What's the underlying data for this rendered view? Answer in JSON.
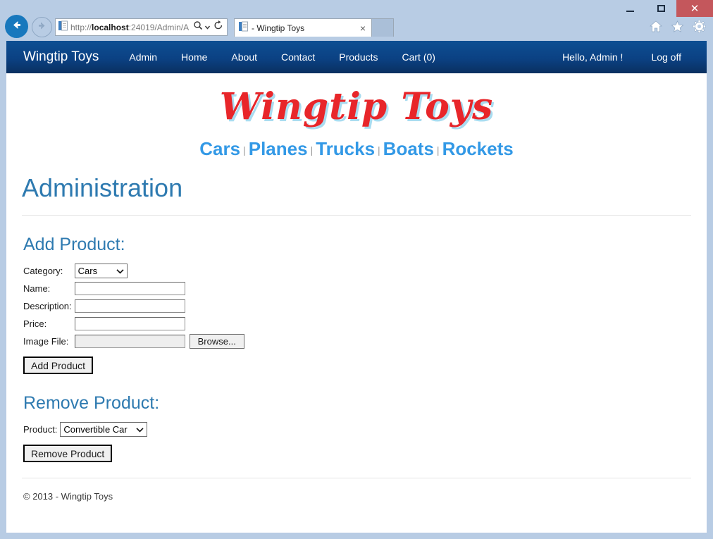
{
  "browser": {
    "url_prefix": "http://",
    "url_host": "localhost",
    "url_rest": ":24019/Admin/A",
    "tab_title": "- Wingtip Toys",
    "tab_close_label": "×",
    "new_tab_label": "",
    "window_controls": {
      "minimize": "minimize-button",
      "maximize": "maximize-button",
      "close_label": "✕"
    },
    "toolbar_icons": [
      "home-icon",
      "favorites-star-icon",
      "settings-gear-icon"
    ],
    "nav_icons": [
      "back-icon",
      "forward-icon"
    ],
    "address_icons": [
      "page-icon",
      "search-icon",
      "dropdown-icon",
      "refresh-icon"
    ]
  },
  "navbar": {
    "brand": "Wingtip Toys",
    "items": [
      {
        "label": "Admin"
      },
      {
        "label": "Home"
      },
      {
        "label": "About"
      },
      {
        "label": "Contact"
      },
      {
        "label": "Products"
      },
      {
        "label": "Cart (0)"
      }
    ],
    "greeting": "Hello, Admin !",
    "logoff": "Log off"
  },
  "site": {
    "logo_text": "Wingtip Toys",
    "categories": [
      {
        "label": "Cars"
      },
      {
        "label": "Planes"
      },
      {
        "label": "Trucks"
      },
      {
        "label": "Boats"
      },
      {
        "label": "Rockets"
      }
    ],
    "category_separator": "|"
  },
  "page": {
    "title": "Administration",
    "add_section": {
      "heading": "Add Product:",
      "fields": {
        "category_label": "Category:",
        "category_value": "Cars",
        "name_label": "Name:",
        "name_value": "",
        "description_label": "Description:",
        "description_value": "",
        "price_label": "Price:",
        "price_value": "",
        "image_label": "Image File:",
        "image_value": "",
        "browse_label": "Browse..."
      },
      "submit_label": "Add Product"
    },
    "remove_section": {
      "heading": "Remove Product:",
      "product_label": "Product:",
      "product_value": "Convertible Car",
      "submit_label": "Remove Product"
    },
    "footer": "© 2013 - Wingtip Toys"
  },
  "colors": {
    "navbar_top": "#0d4f93",
    "navbar_bottom": "#0a3060",
    "heading_blue": "#2e7ab0",
    "link_blue": "#3399e6",
    "logo_red": "#e8262a",
    "logo_shadow": "#a9dcf0",
    "chrome_frame": "#b8cce4",
    "close_red": "#c4575c"
  }
}
